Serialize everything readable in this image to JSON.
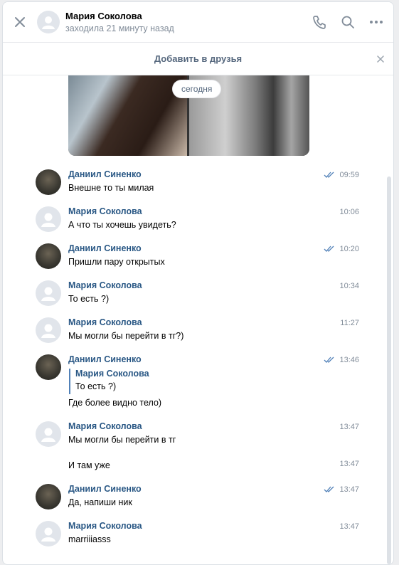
{
  "header": {
    "name": "Мария Соколова",
    "status": "заходила 21 минуту назад",
    "icons": [
      "close-icon",
      "phone-icon",
      "search-icon",
      "more-icon"
    ]
  },
  "friend_bar": {
    "label": "Добавить в друзья"
  },
  "date_label": "сегодня",
  "messages": [
    {
      "sender": "Даниил Синенко",
      "time": "09:59",
      "text": "Внешне то ты милая",
      "read": true
    },
    {
      "sender": "Мария Соколова",
      "time": "10:06",
      "text": "А что ты хочешь увидеть?"
    },
    {
      "sender": "Даниил Синенко",
      "time": "10:20",
      "text": "Пришли пару открытых",
      "read": true
    },
    {
      "sender": "Мария Соколова",
      "time": "10:34",
      "text": "То есть ?)"
    },
    {
      "sender": "Мария Соколова",
      "time": "11:27",
      "text": "Мы могли бы перейти в тг?)"
    },
    {
      "sender": "Даниил Синенко",
      "time": "13:46",
      "read": true,
      "reply": {
        "name": "Мария Соколова",
        "text": "То есть ?)"
      },
      "text": "Где более видно тело)"
    },
    {
      "sender": "Мария Соколова",
      "time": "13:47",
      "text": "Мы могли бы перейти в тг"
    },
    {
      "time": "13:47",
      "text": "И там уже"
    },
    {
      "sender": "Даниил Синенко",
      "time": "13:47",
      "text": "Да, напиши ник",
      "read": true
    },
    {
      "sender": "Мария Соколова",
      "time": "13:47",
      "text": "marriiiasss"
    }
  ]
}
